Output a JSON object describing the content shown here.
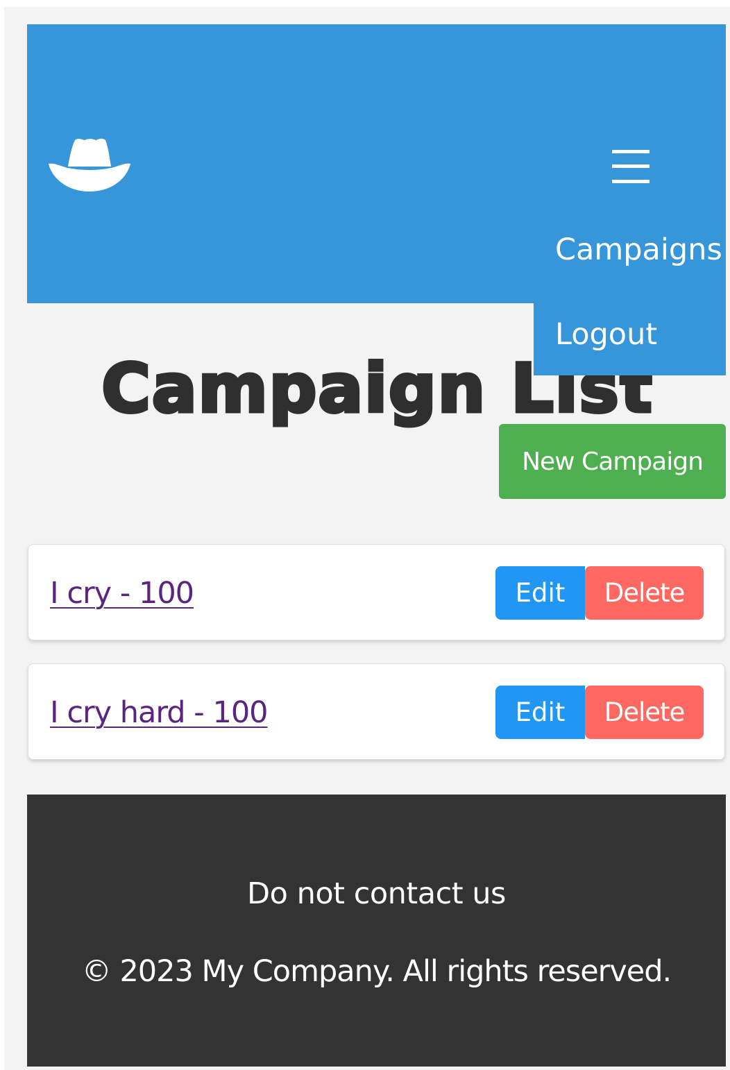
{
  "header": {
    "logo": "cowboy-hat-icon",
    "menu_icon": "hamburger-menu-icon",
    "nav": [
      "Campaigns",
      "Logout"
    ]
  },
  "main": {
    "title": "Campaign List",
    "new_button": "New Campaign",
    "campaigns": [
      {
        "label": "I cry - 100",
        "edit": "Edit",
        "delete": "Delete"
      },
      {
        "label": "I cry hard - 100",
        "edit": "Edit",
        "delete": "Delete"
      }
    ]
  },
  "footer": {
    "contact": "Do not contact us",
    "copyright": "© 2023 My Company. All rights reserved."
  },
  "colors": {
    "header": "#3796d9",
    "new_button": "#4daf4f",
    "edit_button": "#2196f3",
    "delete_button": "#ff6961",
    "footer": "#333333",
    "link": "#5b2480"
  }
}
